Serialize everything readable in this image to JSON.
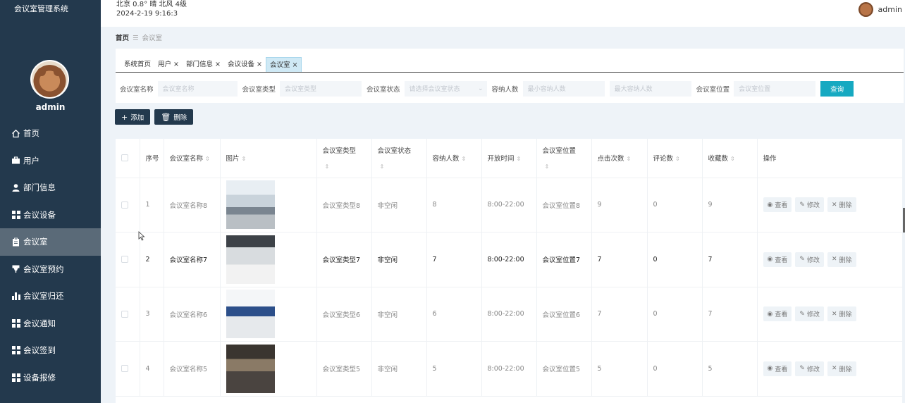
{
  "app": {
    "title": "会议室管理系统"
  },
  "weather": {
    "line1": "北京  0.8°  晴  北风  4级",
    "line2": "2024-2-19 9:16:3"
  },
  "user": {
    "name": "admin"
  },
  "sidebar": {
    "username": "admin",
    "items": [
      {
        "label": "首页",
        "icon": "home-icon"
      },
      {
        "label": "用户",
        "icon": "briefcase-icon"
      },
      {
        "label": "部门信息",
        "icon": "person-icon"
      },
      {
        "label": "会议设备",
        "icon": "grid-icon"
      },
      {
        "label": "会议室",
        "icon": "clipboard-icon"
      },
      {
        "label": "会议室预约",
        "icon": "podium-icon"
      },
      {
        "label": "会议室归还",
        "icon": "bar-chart-icon"
      },
      {
        "label": "会议通知",
        "icon": "grid-icon"
      },
      {
        "label": "会议签到",
        "icon": "grid-icon"
      },
      {
        "label": "设备报修",
        "icon": "grid-icon"
      }
    ]
  },
  "breadcrumb": {
    "home": "首页",
    "sep": "☰",
    "current": "会议室"
  },
  "tabs": [
    {
      "label": "系统首页"
    },
    {
      "label": "用户 ×"
    },
    {
      "label": "部门信息 ×"
    },
    {
      "label": "会议设备 ×"
    },
    {
      "label": "会议室 ×"
    }
  ],
  "filters": {
    "name_label": "会议室名称",
    "name_placeholder": "会议室名称",
    "type_label": "会议室类型",
    "type_placeholder": "会议室类型",
    "status_label": "会议室状态",
    "status_placeholder": "请选择会议室状态",
    "capacity_label": "容纳人数",
    "min_placeholder": "最小容纳人数",
    "max_placeholder": "最大容纳人数",
    "location_label": "会议室位置",
    "location_placeholder": "会议室位置",
    "search_label": "查询"
  },
  "actions": {
    "add": "添加",
    "delete": "删除"
  },
  "table": {
    "headers": {
      "index": "序号",
      "name": "会议室名称",
      "image": "图片",
      "type": "会议室类型",
      "status": "会议室状态",
      "capacity": "容纳人数",
      "hours": "开放时间",
      "location": "会议室位置",
      "clicks": "点击次数",
      "comments": "评论数",
      "favorites": "收藏数",
      "ops": "操作"
    },
    "op_labels": {
      "view": "查看",
      "edit": "修改",
      "delete": "删除"
    },
    "rows": [
      {
        "index": "1",
        "name": "会议室名称8",
        "type": "会议室类型8",
        "status": "非空闲",
        "capacity": "8",
        "hours": "8:00-22:00",
        "location": "会议室位置8",
        "clicks": "9",
        "comments": "0",
        "favorites": "9"
      },
      {
        "index": "2",
        "name": "会议室名称7",
        "type": "会议室类型7",
        "status": "非空闲",
        "capacity": "7",
        "hours": "8:00-22:00",
        "location": "会议室位置7",
        "clicks": "7",
        "comments": "0",
        "favorites": "7"
      },
      {
        "index": "3",
        "name": "会议室名称6",
        "type": "会议室类型6",
        "status": "非空闲",
        "capacity": "6",
        "hours": "8:00-22:00",
        "location": "会议室位置6",
        "clicks": "7",
        "comments": "0",
        "favorites": "7"
      },
      {
        "index": "4",
        "name": "会议室名称5",
        "type": "会议室类型5",
        "status": "非空闲",
        "capacity": "5",
        "hours": "8:00-22:00",
        "location": "会议室位置5",
        "clicks": "5",
        "comments": "0",
        "favorites": "5"
      }
    ]
  },
  "colors": {
    "sidebar": "#23394d",
    "accent": "#16a9c1",
    "active_menu": "#5a6a78",
    "active_tab": "#cfe9f5"
  }
}
